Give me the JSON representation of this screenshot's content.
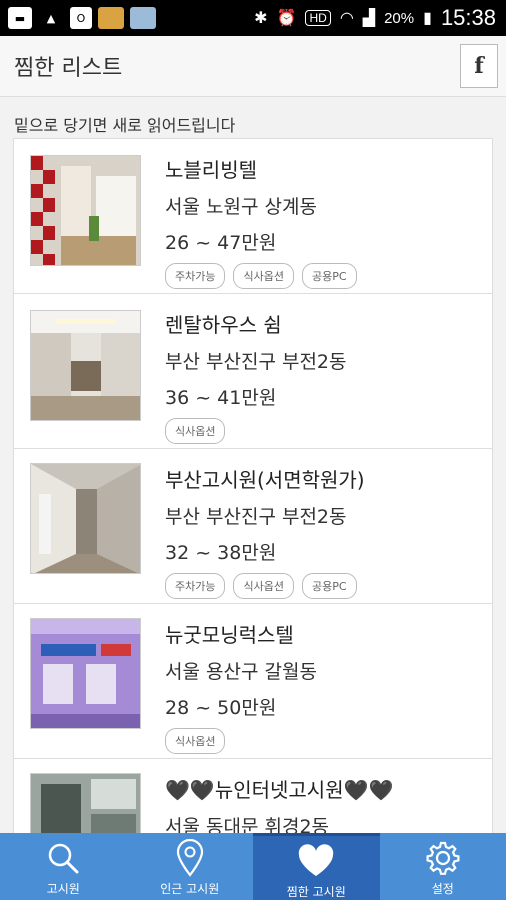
{
  "status_bar": {
    "battery": "20%",
    "time": "15:38",
    "hd_label": "HD"
  },
  "header": {
    "title": "찜한 리스트",
    "facebook_label": "f"
  },
  "pull_hint": "밑으로 당기면 새로 읽어드립니다",
  "listings": [
    {
      "name": "노블리빙텔",
      "address": "서울 노원구 상계동",
      "price": "26 ~ 47만원",
      "tags": [
        "주차가능",
        "식사옵션",
        "공용PC"
      ]
    },
    {
      "name": "렌탈하우스 쉼",
      "address": "부산 부산진구 부전2동",
      "price": "36 ~ 41만원",
      "tags": [
        "식사옵션"
      ]
    },
    {
      "name": "부산고시원(서면학원가)",
      "address": "부산 부산진구 부전2동",
      "price": "32 ~ 38만원",
      "tags": [
        "주차가능",
        "식사옵션",
        "공용PC"
      ]
    },
    {
      "name": "뉴굿모닝럭스텔",
      "address": "서울 용산구 갈월동",
      "price": "28 ~ 50만원",
      "tags": [
        "식사옵션"
      ]
    },
    {
      "name": "뉴인터넷고시원",
      "address": "서울 동대문 휘경2동",
      "price": "",
      "tags": []
    }
  ],
  "tabs": [
    {
      "label": "고시원",
      "icon": "search-icon"
    },
    {
      "label": "인근 고시원",
      "icon": "location-pin-icon"
    },
    {
      "label": "찜한 고시원",
      "icon": "heart-icon",
      "active": true
    },
    {
      "label": "설정",
      "icon": "gear-icon"
    }
  ],
  "colors": {
    "tab_bar": "#4a8fd6",
    "tab_active": "#2e66b6"
  }
}
